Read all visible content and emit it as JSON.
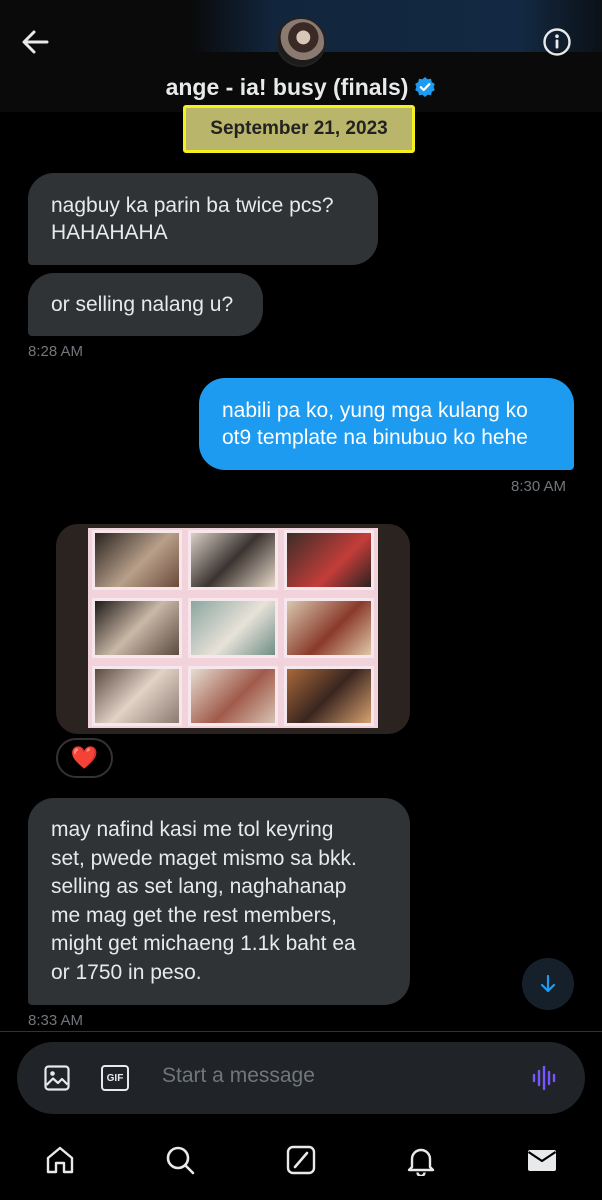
{
  "header": {
    "contact_name": "ange - ia! busy (finals)",
    "verified": true,
    "back_icon": "arrow-left-icon",
    "info_icon": "info-icon"
  },
  "date_separator": "September 21, 2023",
  "messages": [
    {
      "direction": "in",
      "text_lines": [
        "nagbuy ka parin ba twice pcs?",
        "HAHAHAHA"
      ]
    },
    {
      "direction": "in",
      "text_lines": [
        "or selling nalang u?"
      ],
      "time": "8:28 AM"
    },
    {
      "direction": "out",
      "text_lines": [
        "nabili pa ko, yung mga kulang ko",
        "ot9 template na binubuo ko hehe"
      ],
      "time": "8:30 AM"
    },
    {
      "direction": "in",
      "type": "image",
      "reaction": "❤️"
    },
    {
      "direction": "in",
      "text_lines": [
        "may nafind kasi me tol keyring",
        "set, pwede maget mismo sa bkk.",
        "selling as set lang, naghahanap",
        "me mag get the rest members,",
        "might get michaeng 1.1k baht ea",
        "or 1750 in peso."
      ],
      "time": "8:33 AM"
    }
  ],
  "composer": {
    "placeholder": "Start a message",
    "image_icon": "image-icon",
    "gif_label": "GIF",
    "voice_icon": "voice-waveform-icon"
  },
  "tabbar": {
    "items": [
      "home-icon",
      "search-icon",
      "grok-icon",
      "notifications-icon",
      "messages-icon"
    ]
  },
  "colors": {
    "background": "#000000",
    "incoming_bubble": "#2f3336",
    "outgoing_bubble": "#1d9bf0",
    "date_highlight": "#b9b56a",
    "date_highlight_border": "#f4f01e",
    "verified": "#1d9bf0"
  }
}
